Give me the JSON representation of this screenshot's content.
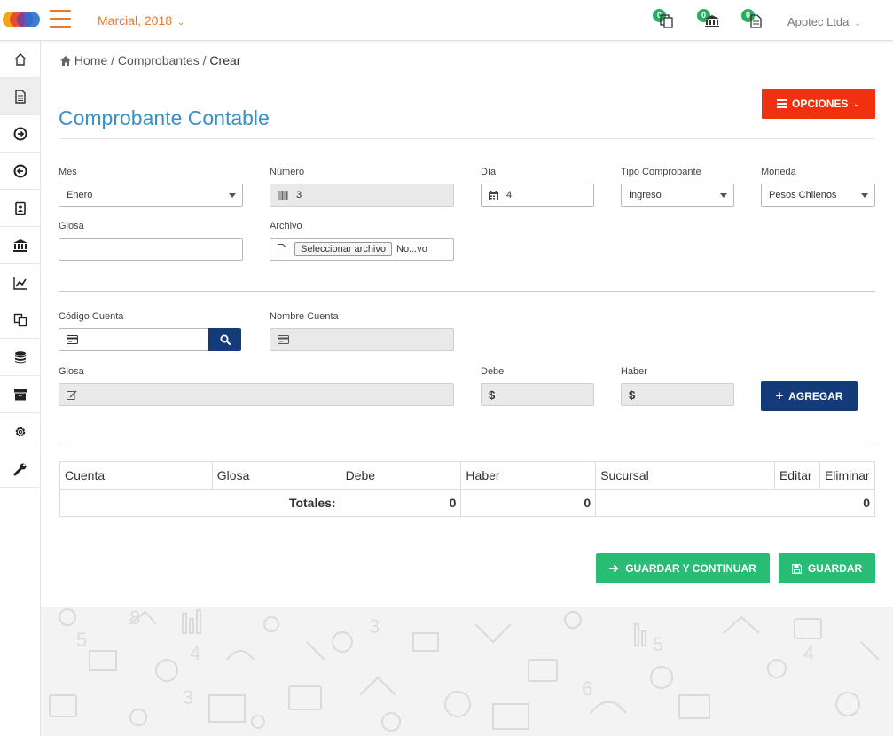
{
  "header": {
    "period": "Marcial, 2018",
    "notifications": [
      {
        "icon": "documents-icon",
        "count": "0"
      },
      {
        "icon": "bank-icon",
        "count": "0"
      },
      {
        "icon": "document-icon",
        "count": "0"
      }
    ],
    "company": "Apptec Ltda"
  },
  "sidebar": {
    "items": [
      "home-icon",
      "document-icon",
      "arrow-in-icon",
      "arrow-out-icon",
      "contacts-icon",
      "bank-icon",
      "chart-icon",
      "copy-icon",
      "database-icon",
      "archive-icon",
      "gear-icon",
      "wrench-icon"
    ]
  },
  "breadcrumb": {
    "home": "Home",
    "section": "Comprobantes",
    "current": "Crear",
    "separator": "/"
  },
  "page": {
    "title": "Comprobante Contable",
    "options_label": "OPCIONES"
  },
  "form": {
    "mes": {
      "label": "Mes",
      "value": "Enero"
    },
    "numero": {
      "label": "Número",
      "value": "3"
    },
    "dia": {
      "label": "Día",
      "value": "4"
    },
    "tipo": {
      "label": "Tipo Comprobante",
      "value": "Ingreso"
    },
    "moneda": {
      "label": "Moneda",
      "value": "Pesos Chilenos"
    },
    "glosa": {
      "label": "Glosa",
      "value": ""
    },
    "archivo": {
      "label": "Archivo",
      "button": "Seleccionar archivo",
      "status": "No...vo"
    }
  },
  "detail_form": {
    "codigo_cuenta": {
      "label": "Código Cuenta",
      "value": ""
    },
    "nombre_cuenta": {
      "label": "Nombre Cuenta",
      "value": ""
    },
    "glosa": {
      "label": "Glosa",
      "value": ""
    },
    "debe": {
      "label": "Debe",
      "prefix": "$"
    },
    "haber": {
      "label": "Haber",
      "prefix": "$"
    },
    "add_label": "AGREGAR"
  },
  "table": {
    "headers": [
      "Cuenta",
      "Glosa",
      "Debe",
      "Haber",
      "Sucursal",
      "Editar",
      "Eliminar"
    ],
    "totals_label": "Totales:",
    "totals": {
      "debe": "0",
      "haber": "0",
      "total": "0"
    }
  },
  "actions": {
    "save_continue": "GUARDAR Y CONTINUAR",
    "save": "GUARDAR"
  },
  "colors": {
    "accent_orange": "#e8792c",
    "title_blue": "#3a8fc9",
    "danger": "#f0300f",
    "primary": "#143b79",
    "success": "#29bc75"
  }
}
